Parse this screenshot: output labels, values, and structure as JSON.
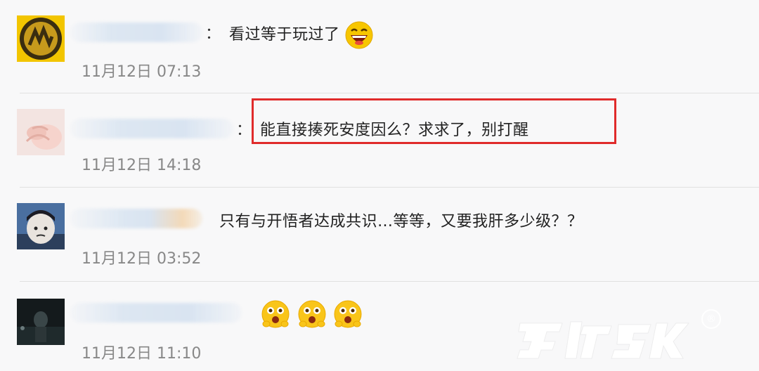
{
  "comments": [
    {
      "text": "看过等于玩过了",
      "time": "11月12日 07:13",
      "colon": "：",
      "emoji": [
        "laughing-emoji"
      ]
    },
    {
      "text": "能直接揍死安度因么？求求了，别打醒",
      "time": "11月12日 14:18",
      "colon": "：",
      "highlighted": true,
      "highlight_color": "#e02b2b"
    },
    {
      "text": "只有与开悟者达成共识…等等，又要我肝多少级？？",
      "time": "11月12日 03:52",
      "colon": ""
    },
    {
      "text": "",
      "time": "11月12日 11:10",
      "colon": "",
      "emoji": [
        "shocked-emoji",
        "shocked-emoji",
        "shocked-emoji"
      ]
    }
  ],
  "watermark": {
    "icon": "registered-mark-icon"
  },
  "colors": {
    "background": "#f8f8f9",
    "time_text": "#888888",
    "divider": "#e1e1e1"
  }
}
